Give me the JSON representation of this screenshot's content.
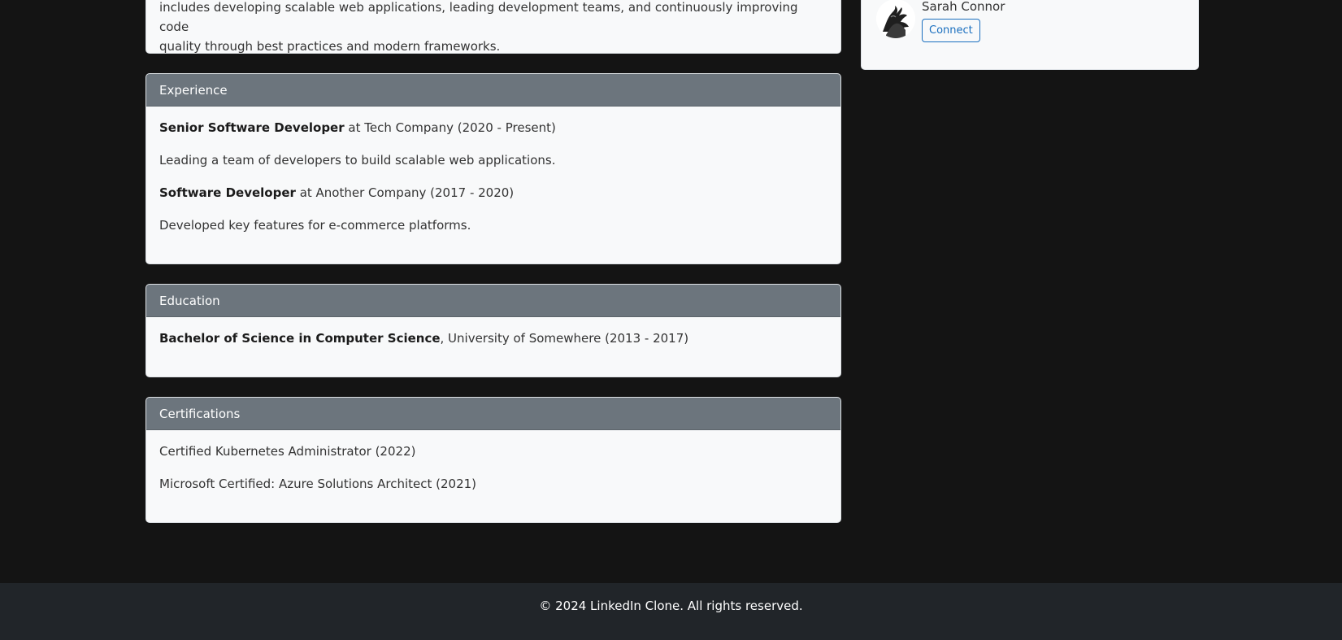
{
  "about": {
    "line1": "includes developing scalable web applications, leading development teams, and continuously improving code",
    "line2": "quality through best practices and modern frameworks."
  },
  "experience": {
    "header": "Experience",
    "items": [
      {
        "title": "Senior Software Developer",
        "detail": " at Tech Company (2020 - Present)",
        "description": "Leading a team of developers to build scalable web applications."
      },
      {
        "title": "Software Developer",
        "detail": " at Another Company (2017 - 2020)",
        "description": "Developed key features for e-commerce platforms."
      }
    ]
  },
  "education": {
    "header": "Education",
    "degree": "Bachelor of Science in Computer Science",
    "detail": ", University of Somewhere (2013 - 2017)"
  },
  "certifications": {
    "header": "Certifications",
    "items": [
      "Certified Kubernetes Administrator (2022)",
      "Microsoft Certified: Azure Solutions Architect (2021)"
    ]
  },
  "people": {
    "name": "Sarah Connor",
    "connect_label": "Connect",
    "avatar_icon": "profile-photo-hands"
  },
  "footer": {
    "text": "© 2024 LinkedIn Clone. All rights reserved."
  },
  "colors": {
    "background": "#141414",
    "card_header": "#6c757d",
    "card_body": "#f8f9fa",
    "footer": "#212529",
    "connect_accent": "#1a6fbf"
  }
}
